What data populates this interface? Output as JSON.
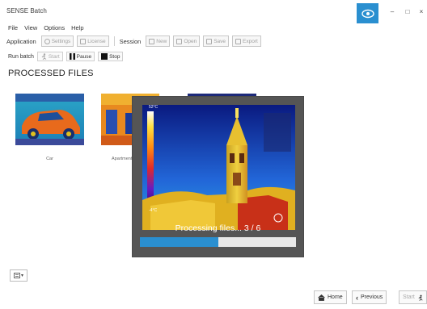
{
  "window": {
    "title": "SENSE Batch",
    "buttons": {
      "minimize": "–",
      "maximize": "□",
      "close": "×"
    }
  },
  "menu": [
    "File",
    "View",
    "Options",
    "Help"
  ],
  "toolbar": {
    "application_label": "Application",
    "settings": "Settings",
    "license": "License",
    "session_label": "Session",
    "new": "New",
    "open": "Open",
    "save": "Save",
    "export": "Export"
  },
  "runbar": {
    "label": "Run batch",
    "start": "Start",
    "pause": "Pause",
    "stop": "Stop"
  },
  "section_title": "PROCESSED FILES",
  "thumbnails": [
    {
      "label": "Car"
    },
    {
      "label": "Apartment"
    }
  ],
  "overlay": {
    "scale_top": "52°C",
    "scale_bottom": "-4°C",
    "status_text": "Processing files... 3 / 6",
    "progress": 0.5
  },
  "nav": {
    "home": "Home",
    "previous": "Previous",
    "start": "Start"
  },
  "colors": {
    "accent": "#2a8fd0"
  }
}
